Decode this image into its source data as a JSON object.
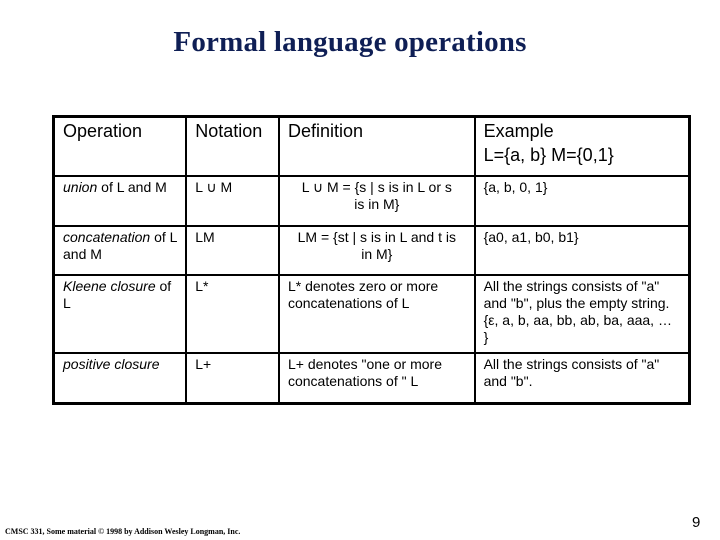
{
  "slide": {
    "title": "Formal language operations",
    "footer": "CMSC 331, Some material © 1998 by Addison Wesley Longman, Inc.",
    "page_number": "9",
    "title_color": "#0f1f55"
  },
  "table": {
    "headers": {
      "operation": "Operation",
      "notation": "Notation",
      "definition": "Definition",
      "example": "Example",
      "example_sub": "L={a, b}  M={0,1}"
    },
    "rows": [
      {
        "operation_em": "union",
        "operation_rest": " of L and M",
        "notation": "L ∪ M",
        "definition_line1": "L ∪ M = {s | s is in L or s",
        "definition_line2": "is in M}",
        "example": "{a, b, 0, 1}"
      },
      {
        "operation_em": "concatenation",
        "operation_rest": " of L and M",
        "notation": "LM",
        "definition_line1": "LM = {st | s is in L and t is",
        "definition_line2": "in M}",
        "example": "{a0, a1, b0, b1}"
      },
      {
        "operation_em": "Kleene closure",
        "operation_rest": " of L",
        "notation": "L*",
        "definition_line1": "L* denotes zero or more concatenations of  L",
        "definition_line2": "",
        "example": "All the strings consists of \"a\" and \"b\", plus the empty string. {ε, a, b, aa, bb, ab, ba,  aaa, … }"
      },
      {
        "operation_em": "positive closure",
        "operation_rest": "",
        "notation": "L+",
        "definition_line1": "L+ denotes \"one or more concatenations of \" L",
        "definition_line2": "",
        "example": "All the strings consists of \"a\" and \"b\"."
      }
    ]
  }
}
